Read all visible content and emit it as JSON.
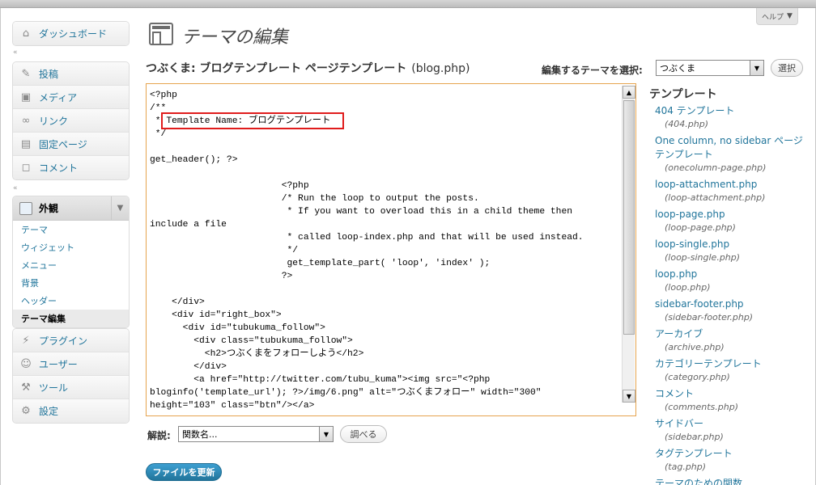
{
  "help": {
    "label": "ヘルプ"
  },
  "sidebar": {
    "dashboard": "ダッシュボード",
    "group1": [
      "投稿",
      "メディア",
      "リンク",
      "固定ページ",
      "コメント"
    ],
    "appearance": {
      "label": "外観",
      "submenu": [
        "テーマ",
        "ウィジェット",
        "メニュー",
        "背景",
        "ヘッダー",
        "テーマ編集"
      ]
    },
    "group2": [
      "プラグイン",
      "ユーザー",
      "ツール",
      "設定"
    ]
  },
  "header": {
    "title": "テーマの編集",
    "file_title": "つぶくま: ブログテンプレート ページテンプレート",
    "file_name": "(blog.php)",
    "select_label": "編集するテーマを選択:",
    "select_value": "つぶくま",
    "select_button": "選択"
  },
  "editor": {
    "code": "<?php\n/**\n * Template Name: ブログテンプレート\n */\n\nget_header(); ?>\n\n                        <?php\n                        /* Run the loop to output the posts.\n                         * If you want to overload this in a child theme then\ninclude a file\n                         * called loop-index.php and that will be used instead.\n                         */\n                         get_template_part( 'loop', 'index' );\n                        ?>\n\n    </div>\n    <div id=\"right_box\">\n      <div id=\"tubukuma_follow\">\n        <div class=\"tubukuma_follow\">\n          <h2>つぶくまをフォローしよう</h2>\n        </div>\n        <a href=\"http://twitter.com/tubu_kuma\"><img src=\"<?php\nbloginfo('template_url'); ?>/img/6.png\" alt=\"つぶくまフォロー\" width=\"300\"\nheight=\"103\" class=\"btn\"/></a>"
  },
  "docs": {
    "label": "解説:",
    "select_value": "関数名...",
    "lookup_button": "調べる"
  },
  "update_button": "ファイルを更新",
  "templates": {
    "heading": "テンプレート",
    "items": [
      {
        "name": "404 テンプレート",
        "file": "(404.php)"
      },
      {
        "name": "One column, no sidebar ページテンプレート",
        "file": "(onecolumn-page.php)"
      },
      {
        "name": "loop-attachment.php",
        "file": "(loop-attachment.php)"
      },
      {
        "name": "loop-page.php",
        "file": "(loop-page.php)"
      },
      {
        "name": "loop-single.php",
        "file": "(loop-single.php)"
      },
      {
        "name": "loop.php",
        "file": "(loop.php)"
      },
      {
        "name": "sidebar-footer.php",
        "file": "(sidebar-footer.php)"
      },
      {
        "name": "アーカイブ",
        "file": "(archive.php)"
      },
      {
        "name": "カテゴリーテンプレート",
        "file": "(category.php)"
      },
      {
        "name": "コメント",
        "file": "(comments.php)"
      },
      {
        "name": "サイドバー",
        "file": "(sidebar.php)"
      },
      {
        "name": "タグテンプレート",
        "file": "(tag.php)"
      },
      {
        "name": "テーマのための関数",
        "file": ""
      }
    ]
  },
  "colors": {
    "link": "#21759b",
    "highlight": "#e01c1c",
    "editor_border": "#e6a44f"
  }
}
